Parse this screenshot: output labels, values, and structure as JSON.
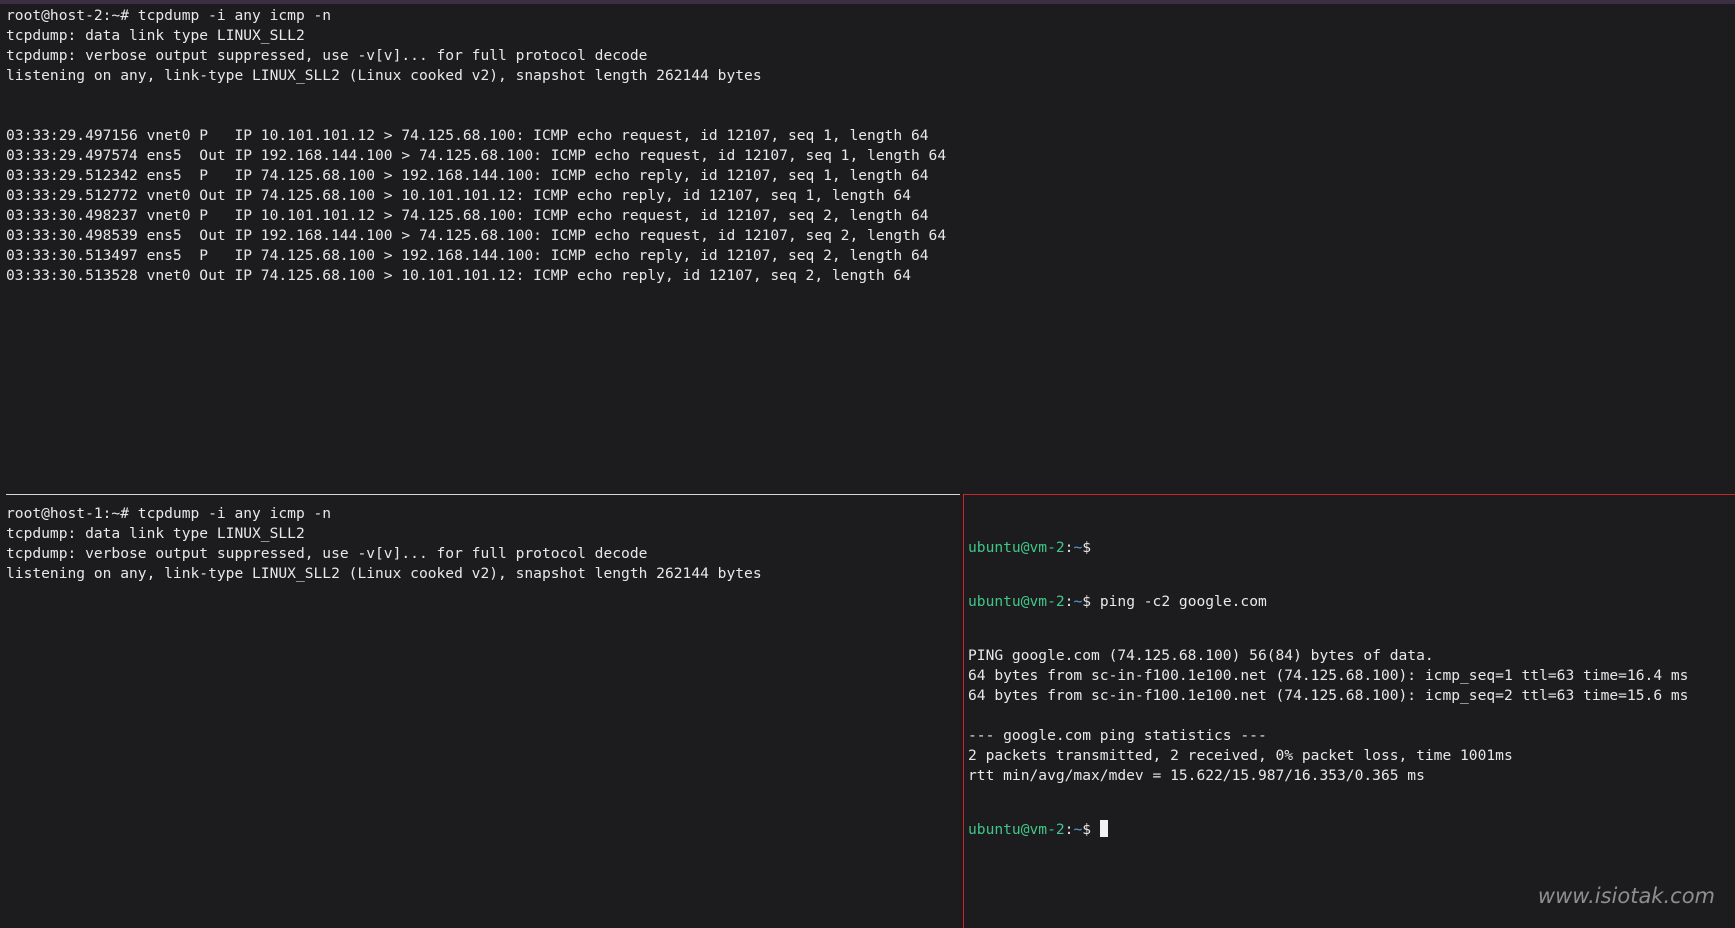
{
  "top_pane": {
    "lines": [
      "root@host-2:~# tcpdump -i any icmp -n",
      "tcpdump: data link type LINUX_SLL2",
      "tcpdump: verbose output suppressed, use -v[v]... for full protocol decode",
      "listening on any, link-type LINUX_SLL2 (Linux cooked v2), snapshot length 262144 bytes",
      "",
      "",
      "03:33:29.497156 vnet0 P   IP 10.101.101.12 > 74.125.68.100: ICMP echo request, id 12107, seq 1, length 64",
      "03:33:29.497574 ens5  Out IP 192.168.144.100 > 74.125.68.100: ICMP echo request, id 12107, seq 1, length 64",
      "03:33:29.512342 ens5  P   IP 74.125.68.100 > 192.168.144.100: ICMP echo reply, id 12107, seq 1, length 64",
      "03:33:29.512772 vnet0 Out IP 74.125.68.100 > 10.101.101.12: ICMP echo reply, id 12107, seq 1, length 64",
      "03:33:30.498237 vnet0 P   IP 10.101.101.12 > 74.125.68.100: ICMP echo request, id 12107, seq 2, length 64",
      "03:33:30.498539 ens5  Out IP 192.168.144.100 > 74.125.68.100: ICMP echo request, id 12107, seq 2, length 64",
      "03:33:30.513497 ens5  P   IP 74.125.68.100 > 192.168.144.100: ICMP echo reply, id 12107, seq 2, length 64",
      "03:33:30.513528 vnet0 Out IP 74.125.68.100 > 10.101.101.12: ICMP echo reply, id 12107, seq 2, length 64"
    ]
  },
  "bottom_left_pane": {
    "lines": [
      "root@host-1:~# tcpdump -i any icmp -n",
      "tcpdump: data link type LINUX_SLL2",
      "tcpdump: verbose output suppressed, use -v[v]... for full protocol decode",
      "listening on any, link-type LINUX_SLL2 (Linux cooked v2), snapshot length 262144 bytes"
    ]
  },
  "bottom_right_pane": {
    "prompt": {
      "user_host": "ubuntu@vm-2",
      "separator": ":",
      "path": "~",
      "symbol": "$"
    },
    "command": " ping -c2 google.com",
    "output": [
      "PING google.com (74.125.68.100) 56(84) bytes of data.",
      "64 bytes from sc-in-f100.1e100.net (74.125.68.100): icmp_seq=1 ttl=63 time=16.4 ms",
      "64 bytes from sc-in-f100.1e100.net (74.125.68.100): icmp_seq=2 ttl=63 time=15.6 ms",
      "",
      "--- google.com ping statistics ---",
      "2 packets transmitted, 2 received, 0% packet loss, time 1001ms",
      "rtt min/avg/max/mdev = 15.622/15.987/16.353/0.365 ms"
    ]
  },
  "watermark": "www.isiotak.com",
  "colors": {
    "background": "#1c1c1e",
    "text": "#e8e8e8",
    "prompt_user": "#3fc68a",
    "prompt_path": "#4aa3e6",
    "active_pane_border": "#c0282c"
  }
}
